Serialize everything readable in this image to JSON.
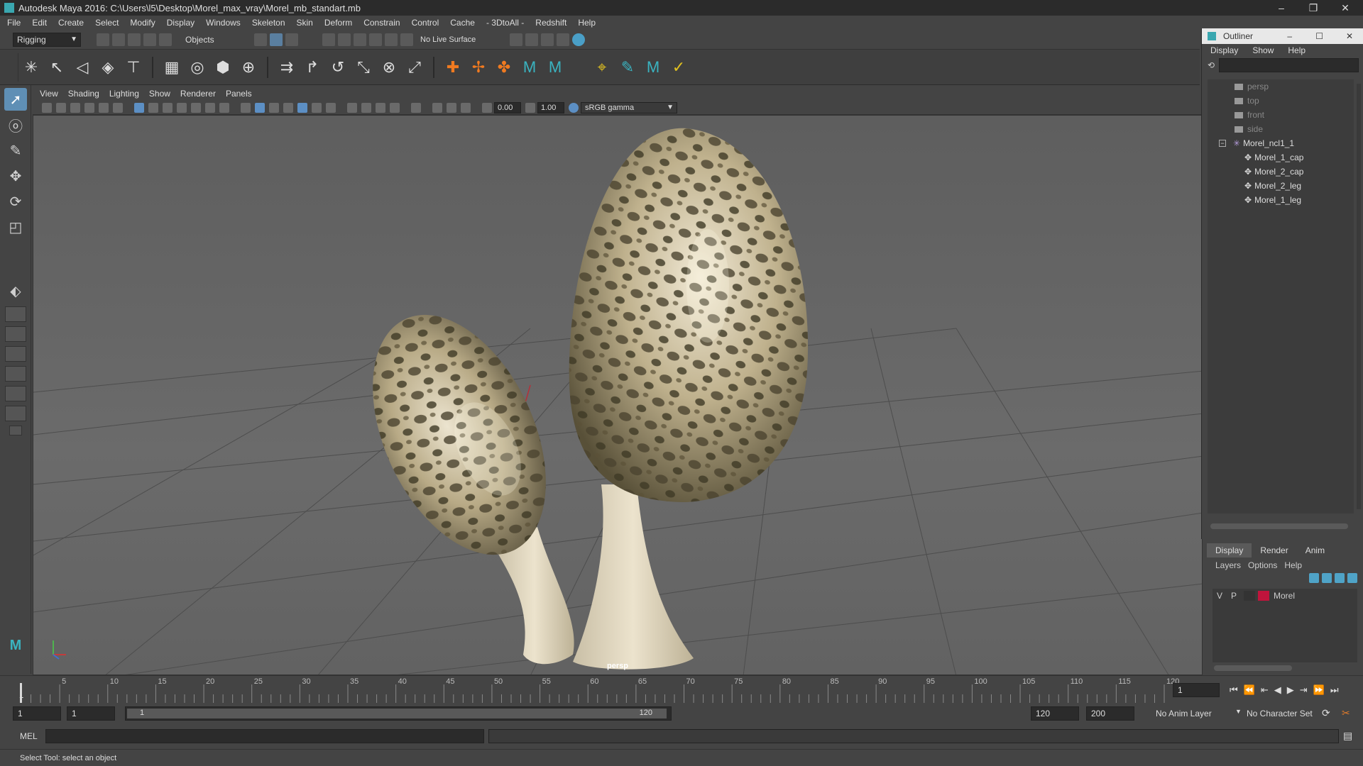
{
  "window": {
    "title": "Autodesk Maya 2016: C:\\Users\\l5\\Desktop\\Morel_max_vray\\Morel_mb_standart.mb",
    "minimize": "–",
    "restore": "❐",
    "close": "✕"
  },
  "menubar": [
    "File",
    "Edit",
    "Create",
    "Select",
    "Modify",
    "Display",
    "Windows",
    "Skeleton",
    "Skin",
    "Deform",
    "Constrain",
    "Control",
    "Cache",
    "- 3DtoAll -",
    "Redshift",
    "Help"
  ],
  "statusline": {
    "mode": "Rigging",
    "selection_mode": "Objects",
    "live_surface": "No Live Surface"
  },
  "panel_menu": [
    "View",
    "Shading",
    "Lighting",
    "Show",
    "Renderer",
    "Panels"
  ],
  "panel_tools": {
    "near_value": "0.00",
    "far_value": "1.00",
    "color_space": "sRGB gamma"
  },
  "viewport": {
    "camera_label": "persp"
  },
  "outliner": {
    "title": "Outliner",
    "menu": [
      "Display",
      "Show",
      "Help"
    ],
    "items": [
      {
        "label": "persp",
        "type": "camera",
        "dim": true
      },
      {
        "label": "top",
        "type": "camera",
        "dim": true
      },
      {
        "label": "front",
        "type": "camera",
        "dim": true
      },
      {
        "label": "side",
        "type": "camera",
        "dim": true
      },
      {
        "label": "Morel_ncl1_1",
        "type": "group",
        "dim": false
      },
      {
        "label": "Morel_1_cap",
        "type": "mesh",
        "dim": false
      },
      {
        "label": "Morel_2_cap",
        "type": "mesh",
        "dim": false
      },
      {
        "label": "Morel_2_leg",
        "type": "mesh",
        "dim": false
      },
      {
        "label": "Morel_1_leg",
        "type": "mesh",
        "dim": false
      }
    ]
  },
  "layer_editor": {
    "tabs": [
      "Display",
      "Render",
      "Anim"
    ],
    "menu": [
      "Layers",
      "Options",
      "Help"
    ],
    "layer": {
      "visible": "V",
      "playback": "P",
      "name": "Morel",
      "color": "#c0143c"
    }
  },
  "timeline": {
    "ticks": [
      "5",
      "10",
      "15",
      "20",
      "25",
      "30",
      "35",
      "40",
      "45",
      "50",
      "55",
      "60",
      "65",
      "70",
      "75",
      "80",
      "85",
      "90",
      "95",
      "100",
      "105",
      "110",
      "115",
      "120"
    ],
    "current_frame": "1",
    "start_tick": "1"
  },
  "range": {
    "start": "1",
    "playback_start": "1",
    "range_label_start": "1",
    "range_label_end": "120",
    "playback_end": "120",
    "end": "200",
    "anim_layer": "No Anim Layer",
    "character_set": "No Character Set"
  },
  "command_line": {
    "label": "MEL"
  },
  "help_line": {
    "text": "Select Tool: select an object"
  }
}
